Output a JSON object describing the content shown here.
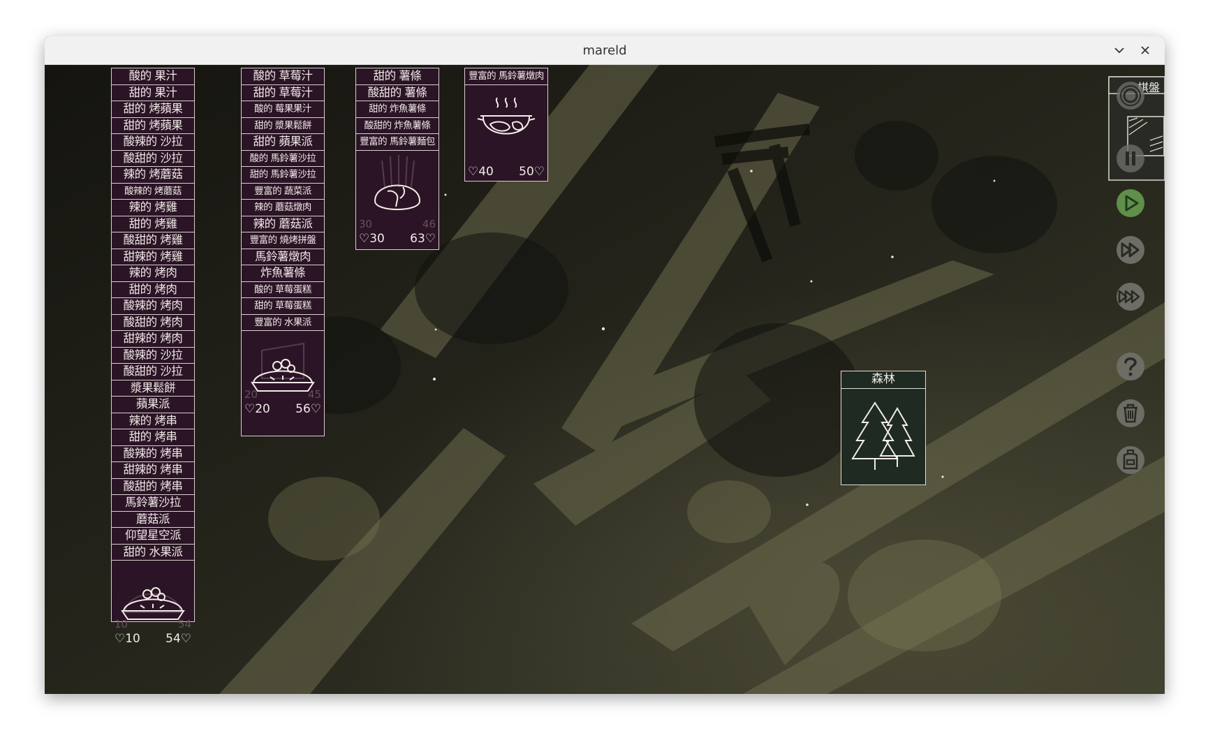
{
  "window": {
    "title": "mareld"
  },
  "stacks": [
    {
      "rows": [
        "酸的 果汁",
        "甜的 果汁",
        "甜的 烤蘋果",
        "甜的 烤蘋果",
        "酸辣的 沙拉",
        "酸甜的 沙拉",
        "辣的 烤蘑菇",
        "酸辣的 烤蘑菇",
        "辣的 烤雞",
        "甜的 烤雞",
        "酸甜的 烤雞",
        "甜辣的 烤雞",
        "辣的 烤肉",
        "甜的 烤肉",
        "酸辣的 烤肉",
        "酸甜的 烤肉",
        "甜辣的 烤肉",
        "酸辣的 沙拉",
        "酸甜的 沙拉",
        "漿果鬆餅",
        "蘋果派",
        "辣的 烤串",
        "甜的 烤串",
        "酸辣的 烤串",
        "甜辣的 烤串",
        "酸甜的 烤串",
        "馬鈴薯沙拉",
        "蘑菇派",
        "仰望星空派",
        "甜的 水果派"
      ],
      "card_icon": "pie-icon",
      "ghost_left": "10",
      "ghost_right": "54",
      "stat_left": "♡10",
      "stat_right": "54♡"
    },
    {
      "rows": [
        "酸的 草莓汁",
        "甜的 草莓汁",
        "酸的 莓果果汁",
        "甜的 漿果鬆餅",
        "甜的 蘋果派",
        "酸的 馬鈴薯沙拉",
        "甜的 馬鈴薯沙拉",
        "豐富的 蔬菜派",
        "辣的 蘑菇燉肉",
        "辣的 蘑菇派",
        "豐富的 燒烤拼盤",
        "馬鈴薯燉肉",
        "炸魚薯條",
        "酸的 草莓蛋糕",
        "甜的 草莓蛋糕",
        "豐富的 水果派"
      ],
      "card_icon": "pie-icon",
      "ghost_left": "20",
      "ghost_right": "45",
      "stat_left": "♡20",
      "stat_right": "56♡"
    },
    {
      "rows": [
        "甜的 薯條",
        "酸甜的 薯條",
        "甜的 炸魚薯條",
        "酸甜的 炸魚薯條",
        "豐富的 馬鈴薯麵包"
      ],
      "card_icon": "bread-icon",
      "ghost_left": "30",
      "ghost_right": "46",
      "stat_left": "♡30",
      "stat_right": "63♡"
    },
    {
      "rows": [
        "豐富的 馬鈴薯燉肉"
      ],
      "card_icon": "stew-pot-icon",
      "stat_left": "♡40",
      "stat_right": "50♡"
    }
  ],
  "forest_card": {
    "label": "森林",
    "icon": "pine-trees-icon"
  },
  "sidebar": {
    "board_label": "棋盤",
    "buttons": [
      "settings-icon",
      "pause-icon",
      "play-icon",
      "fast-forward-icon",
      "fastest-forward-icon",
      "help-icon",
      "trash-icon",
      "backpack-icon"
    ]
  },
  "colors": {
    "card_bg": "#2b1426",
    "card_border": "#d6d0cc",
    "forest_bg": "#1f2a22",
    "play_accent": "#5f8f4a"
  }
}
